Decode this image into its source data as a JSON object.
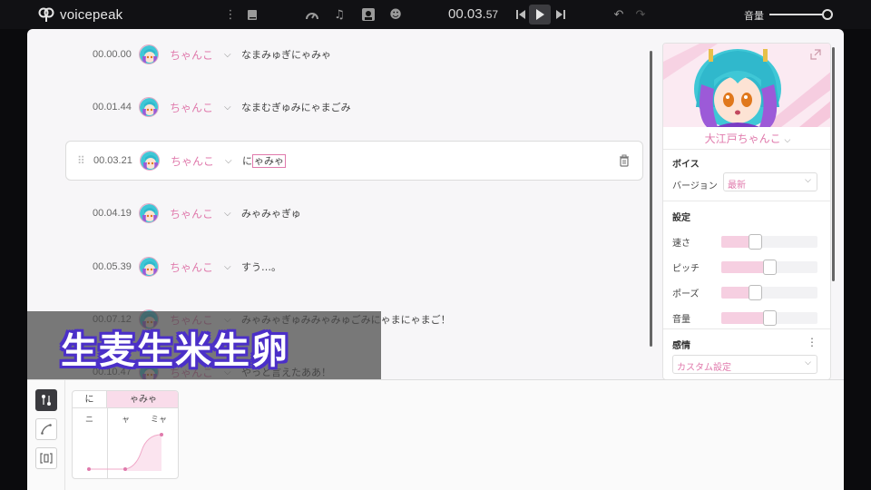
{
  "app": {
    "name": "voicepeak"
  },
  "toolbar": {
    "time_main": "00.03.",
    "time_frac": "57",
    "volume_label": "音量",
    "volume_level": 0.9
  },
  "rows": [
    {
      "time": "00.00.00",
      "name": "ちゃんこ",
      "text": "なまみゅぎにゃみゃ"
    },
    {
      "time": "00.01.44",
      "name": "ちゃんこ",
      "text": "なまむぎゅみにゃまごみ"
    },
    {
      "time": "00.03.21",
      "name": "ちゃんこ",
      "text_pre": "に",
      "text_hl": "ゃみゃ"
    },
    {
      "time": "00.04.19",
      "name": "ちゃんこ",
      "text": "みゃみゃぎゅ"
    },
    {
      "time": "00.05.39",
      "name": "ちゃんこ",
      "text": "すう…。"
    },
    {
      "time": "00.07.12",
      "name": "ちゃんこ",
      "text": "みゃみゃぎゅみみゃみゅごみにゃまにゃまご！"
    },
    {
      "time": "00.10.47",
      "name": "ちゃんこ",
      "text": "やっと言えたああ！"
    }
  ],
  "subtitle": "生麦生米生卵",
  "side": {
    "character": "大江戸ちゃんこ",
    "voice_section": "ボイス",
    "version_label": "バージョン",
    "version_value": "最新",
    "settings_section": "設定",
    "sliders": [
      {
        "label": "速さ",
        "value": 0.35
      },
      {
        "label": "ピッチ",
        "value": 0.5
      },
      {
        "label": "ポーズ",
        "value": 0.35
      },
      {
        "label": "音量",
        "value": 0.5
      }
    ],
    "emotion_section": "感情",
    "emotion_value": "カスタム設定"
  },
  "phoneme": {
    "syllables": [
      {
        "text": "に",
        "kana": [
          "ニ"
        ]
      },
      {
        "text": "ゃみゃ",
        "kana": [
          "ャ",
          "ミャ"
        ]
      }
    ]
  },
  "colors": {
    "accent": "#e07aac",
    "subtitle_outline": "#4b2fc8"
  }
}
